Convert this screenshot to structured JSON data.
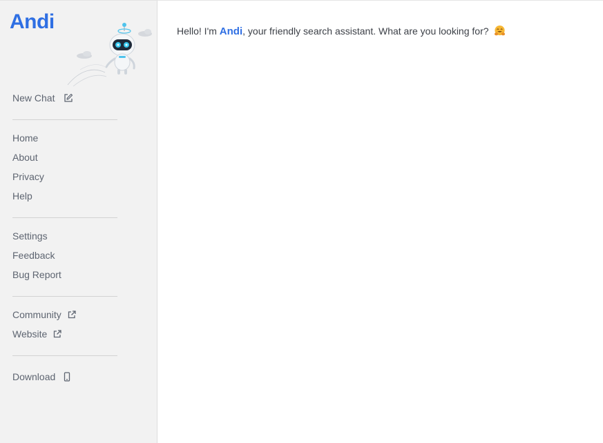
{
  "sidebar": {
    "logo_text": "Andi",
    "new_chat_label": "New Chat",
    "group_main": [
      "Home",
      "About",
      "Privacy",
      "Help"
    ],
    "group_settings": [
      "Settings",
      "Feedback",
      "Bug Report"
    ],
    "group_external": [
      "Community",
      "Website"
    ],
    "download_label": "Download"
  },
  "main": {
    "greeting_prefix": "Hello! I'm ",
    "greeting_brand": "Andi",
    "greeting_suffix": ", your friendly search assistant. What are you looking for?",
    "greeting_emoji": "hugging-face-emoji"
  },
  "colors": {
    "brand_blue": "#2f6fe3",
    "sidebar_bg": "#f2f2f2",
    "nav_text": "#5d6470"
  },
  "icons": {
    "new_chat": "edit-icon",
    "community": "external-link-icon",
    "website": "external-link-icon",
    "download": "mobile-phone-icon"
  }
}
